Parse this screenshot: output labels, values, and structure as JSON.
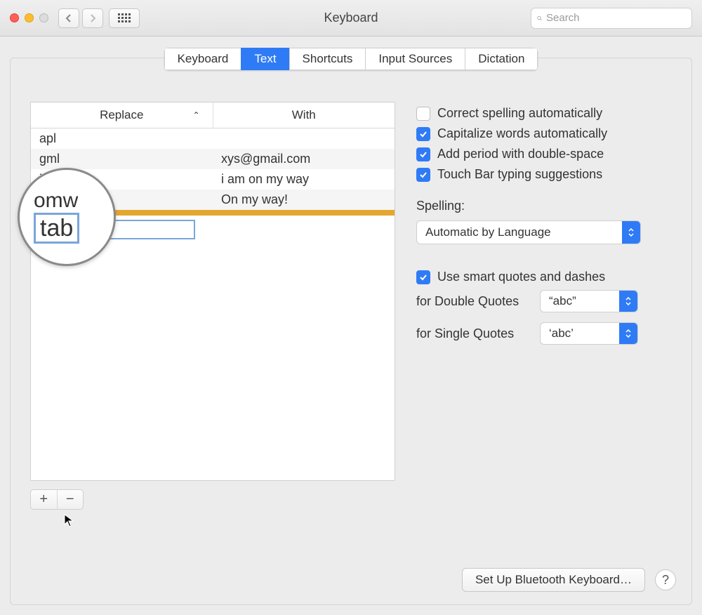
{
  "window": {
    "title": "Keyboard",
    "search_placeholder": "Search"
  },
  "tabs": [
    {
      "label": "Keyboard",
      "active": false
    },
    {
      "label": "Text",
      "active": true
    },
    {
      "label": "Shortcuts",
      "active": false
    },
    {
      "label": "Input Sources",
      "active": false
    },
    {
      "label": "Dictation",
      "active": false
    }
  ],
  "table": {
    "header_replace": "Replace",
    "header_with": "With",
    "rows": [
      {
        "replace": "apl",
        "with": ""
      },
      {
        "replace": "gml",
        "with": "xys@gmail.com"
      },
      {
        "replace": "imw",
        "with": "i am on my way"
      },
      {
        "replace": "omw",
        "with": "On my way!"
      },
      {
        "replace": "tab",
        "with": "",
        "selected": true,
        "editing": true
      }
    ],
    "editing_value": "tab",
    "magnifier_top": "omw",
    "magnifier_bottom": "tab"
  },
  "options": {
    "correct_spelling": {
      "label": "Correct spelling automatically",
      "checked": false
    },
    "capitalize": {
      "label": "Capitalize words automatically",
      "checked": true
    },
    "add_period": {
      "label": "Add period with double-space",
      "checked": true
    },
    "touch_bar": {
      "label": "Touch Bar typing suggestions",
      "checked": true
    },
    "spelling_label": "Spelling:",
    "spelling_value": "Automatic by Language",
    "smart_quotes": {
      "label": "Use smart quotes and dashes",
      "checked": true
    },
    "double_quotes_label": "for Double Quotes",
    "double_quotes_value": "“abc”",
    "single_quotes_label": "for Single Quotes",
    "single_quotes_value": "‘abc’"
  },
  "buttons": {
    "setup_bt": "Set Up Bluetooth Keyboard…",
    "help": "?"
  }
}
